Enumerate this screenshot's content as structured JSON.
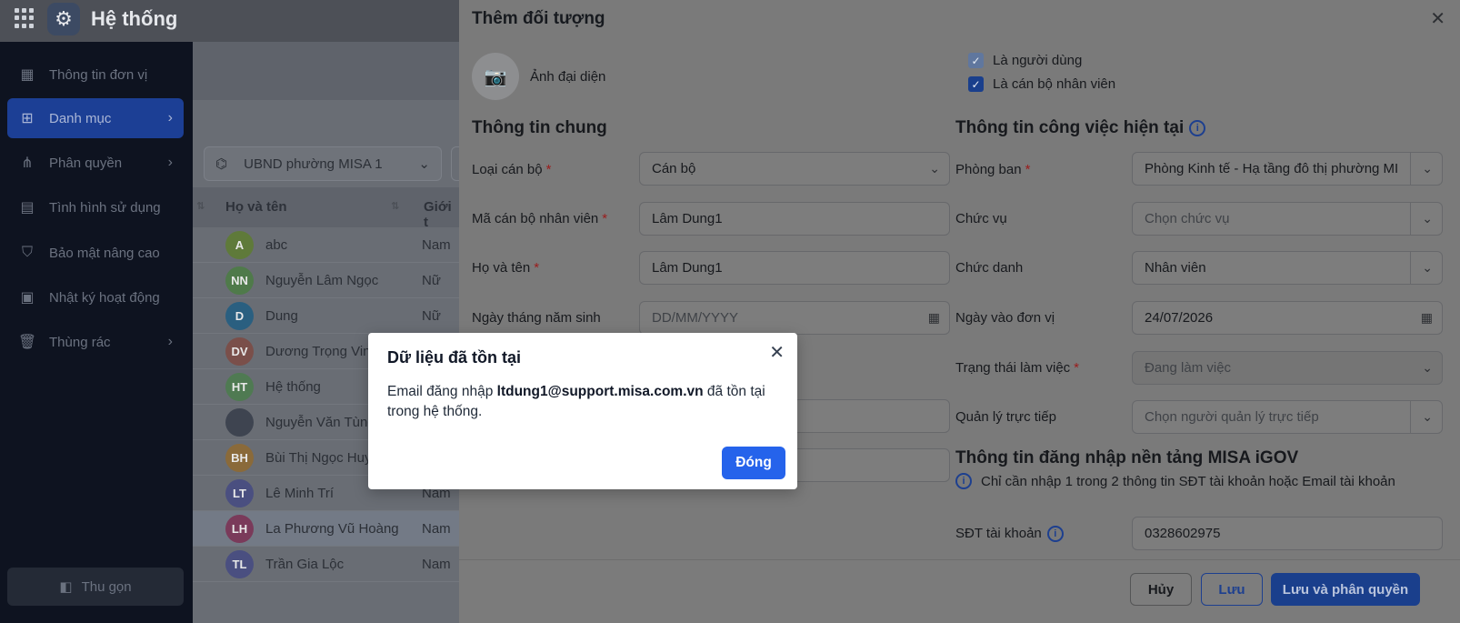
{
  "app": {
    "title": "Hệ thống"
  },
  "sidebar": {
    "items": [
      {
        "label": "Thông tin đơn vị",
        "icon": "building-icon"
      },
      {
        "label": "Danh mục",
        "icon": "grid-icon",
        "active": true
      },
      {
        "label": "Phân quyền",
        "icon": "network-icon"
      },
      {
        "label": "Tình hình sử dụng",
        "icon": "report-icon"
      },
      {
        "label": "Bảo mật nâng cao",
        "icon": "shield-icon"
      },
      {
        "label": "Nhật ký hoạt động",
        "icon": "log-icon"
      },
      {
        "label": "Thùng rác",
        "icon": "trash-icon"
      }
    ],
    "collapse_label": "Thu gọn"
  },
  "list": {
    "org_select": "UBND phường MISA 1",
    "headers": {
      "name": "Họ và tên",
      "gender": "Giới t"
    },
    "rows": [
      {
        "initials": "A",
        "name": "abc",
        "gender": "Nam",
        "color": "#5f7a3a"
      },
      {
        "initials": "NN",
        "name": "Nguyễn Lâm Ngọc",
        "gender": "Nữ",
        "color": "#4f7a4a"
      },
      {
        "initials": "D",
        "name": "Dung",
        "gender": "Nữ",
        "color": "#2a5f80"
      },
      {
        "initials": "DV",
        "name": "Dương Trọng Vinh",
        "gender": "",
        "color": "#7a4f4a"
      },
      {
        "initials": "HT",
        "name": "Hệ thống",
        "gender": "",
        "color": "#4f7a52"
      },
      {
        "initials": "",
        "name": "Nguyễn Văn Tùng",
        "gender": "",
        "color": "#3e4450"
      },
      {
        "initials": "BH",
        "name": "Bùi Thị Ngọc Huy",
        "gender": "",
        "color": "#8a6a3a"
      },
      {
        "initials": "LT",
        "name": "Lê Minh Trí",
        "gender": "Nam",
        "color": "#4a4f80"
      },
      {
        "initials": "LH",
        "name": "La Phương Vũ Hoàng",
        "gender": "Nam",
        "color": "#7a3a5a"
      },
      {
        "initials": "TL",
        "name": "Trần Gia Lộc",
        "gender": "Nam",
        "color": "#4a4f80"
      }
    ]
  },
  "drawer": {
    "title": "Thêm đối tượng",
    "photo_label": "Ảnh đại diện",
    "check_user": "Là người dùng",
    "check_staff": "Là cán bộ nhân viên",
    "general": {
      "title": "Thông tin chung",
      "type_label": "Loại cán bộ",
      "type_value": "Cán bộ",
      "code_label": "Mã cán bộ nhân viên",
      "code_value": "Lâm Dung1",
      "name_label": "Họ và tên",
      "name_value": "Lâm Dung1",
      "dob_label": "Ngày tháng năm sinh",
      "dob_placeholder": "DD/MM/YYYY"
    },
    "work": {
      "title": "Thông tin công việc hiện tại",
      "dept_label": "Phòng ban",
      "dept_value": "Phòng Kinh tế - Hạ tầng đô thị phường MI",
      "position_label": "Chức vụ",
      "position_placeholder": "Chọn chức vụ",
      "jobtitle_label": "Chức danh",
      "jobtitle_value": "Nhân viên",
      "join_label": "Ngày vào đơn vị",
      "join_value": "24/07/2026",
      "status_label": "Trạng thái làm việc",
      "status_value": "Đang làm việc",
      "manager_label": "Quản lý trực tiếp",
      "manager_placeholder": "Chọn người quản lý trực tiếp"
    },
    "login": {
      "title": "Thông tin đăng nhập nền tảng MISA iGOV",
      "hint": "Chỉ cần nhập 1 trong 2 thông tin SĐT tài khoản hoặc Email tài khoản",
      "phone_label": "SĐT tài khoản",
      "phone_value": "0328602975"
    },
    "buttons": {
      "cancel": "Hủy",
      "save": "Lưu",
      "save_perm": "Lưu và phân quyền"
    }
  },
  "modal": {
    "title": "Dữ liệu đã tồn tại",
    "msg_before": "Email đăng nhập ",
    "msg_email": "ltdung1@support.misa.com.vn",
    "msg_after": " đã tồn tại trong hệ thống.",
    "ok_label": "Đóng"
  }
}
